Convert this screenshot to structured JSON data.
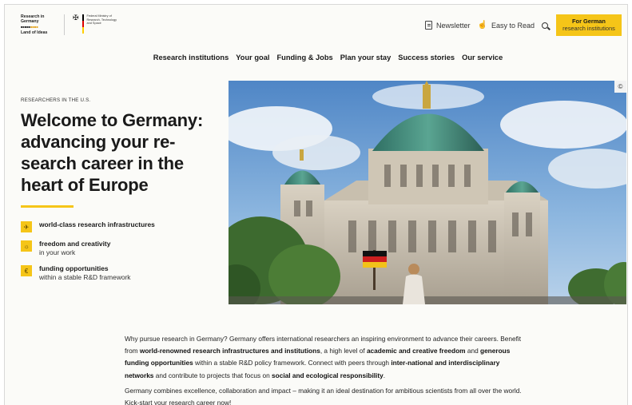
{
  "logo": {
    "line1": "Research in",
    "line2": "Germany",
    "line3": "Land of Ideas",
    "ministry": "Federal Ministry of Research, Technology and Space"
  },
  "header": {
    "newsletter": "Newsletter",
    "easy_to_read": "Easy to Read",
    "cta_line1": "For German",
    "cta_line2": "research institutions"
  },
  "nav": [
    "Research institutions",
    "Your goal",
    "Funding & Jobs",
    "Plan your stay",
    "Success stories",
    "Our service"
  ],
  "hero": {
    "eyebrow": "RESEARCHERS IN THE U.S.",
    "title": "Welcome to Germany: advancing your re-search career in the heart of Europe",
    "copyright": "©"
  },
  "features": [
    {
      "bold": "world-class research infrastructures",
      "sub": ""
    },
    {
      "bold": "freedom and creativity",
      "sub": "in your work"
    },
    {
      "bold": "funding opportunities",
      "sub": "within a stable R&D framework"
    }
  ],
  "intro": {
    "p1_a": "Why pursue research in Germany? Germany offers international researchers an inspiring environment to advance their careers. Benefit from ",
    "p1_b": "world-renowned research infrastructures and institutions",
    "p1_c": ", a high level of ",
    "p1_d": "academic and creative freedom",
    "p1_e": " and ",
    "p1_f": "generous funding opportunities",
    "p1_g": " within a stable R&D policy framework. Connect with peers through ",
    "p1_h": "inter-national and interdisciplinary networks",
    "p1_i": " and contribute to projects that focus on ",
    "p1_j": "social and ecological responsibility",
    "p1_k": ".",
    "p2": "Germany combines excellence, collaboration and impact – making it an ideal destination for ambitious scientists from all over the world. Kick-start your research career now!"
  },
  "colors": {
    "accent": "#f5c518",
    "sky": "#6e9fd1",
    "dome": "#3f8a79"
  }
}
